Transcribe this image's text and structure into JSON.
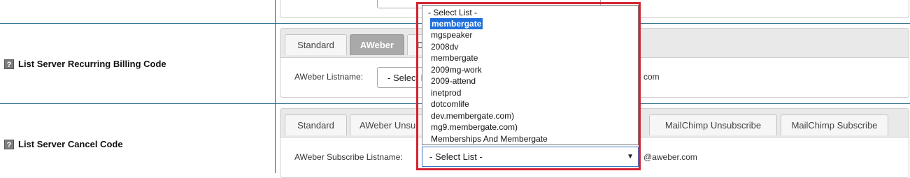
{
  "rows": {
    "billing": {
      "label": "List Server Recurring Billing Code"
    },
    "cancel": {
      "label": "List Server Cancel Code"
    }
  },
  "help_icon": "?",
  "billing_panel": {
    "tabs": [
      {
        "label": "Standard",
        "active": false
      },
      {
        "label": "AWeber",
        "active": true
      },
      {
        "label": "D",
        "active": false
      }
    ],
    "field_label": "AWeber Listname:",
    "select_text": "- Select L",
    "suffix": "com"
  },
  "cancel_panel": {
    "tabs": [
      {
        "label": "Standard"
      },
      {
        "label": "AWeber Unsu"
      },
      {
        "label": "MailChimp Unsubscribe"
      },
      {
        "label": "MailChimp Subscribe"
      }
    ],
    "field_label": "AWeber Subscribe Listname:",
    "suffix": "@aweber.com"
  },
  "dropdown": {
    "selected_value": "- Select List -",
    "options": [
      "- Select List -",
      "membergate",
      "mgspeaker",
      "2008dv",
      "membergate",
      "2009mg-work",
      "2009-attend",
      "inetprod",
      "dotcomlife",
      "dev.membergate.com)",
      "mg9.membergate.com)",
      "Memberships And Membergate"
    ],
    "highlighted_index": 1,
    "caret_icon": "▼"
  },
  "colors": {
    "highlight_frame": "#d42331",
    "selected_option_bg": "#1e6fdb",
    "active_tab_bg": "#a9a9a9",
    "row_border": "#2e6f8e"
  }
}
